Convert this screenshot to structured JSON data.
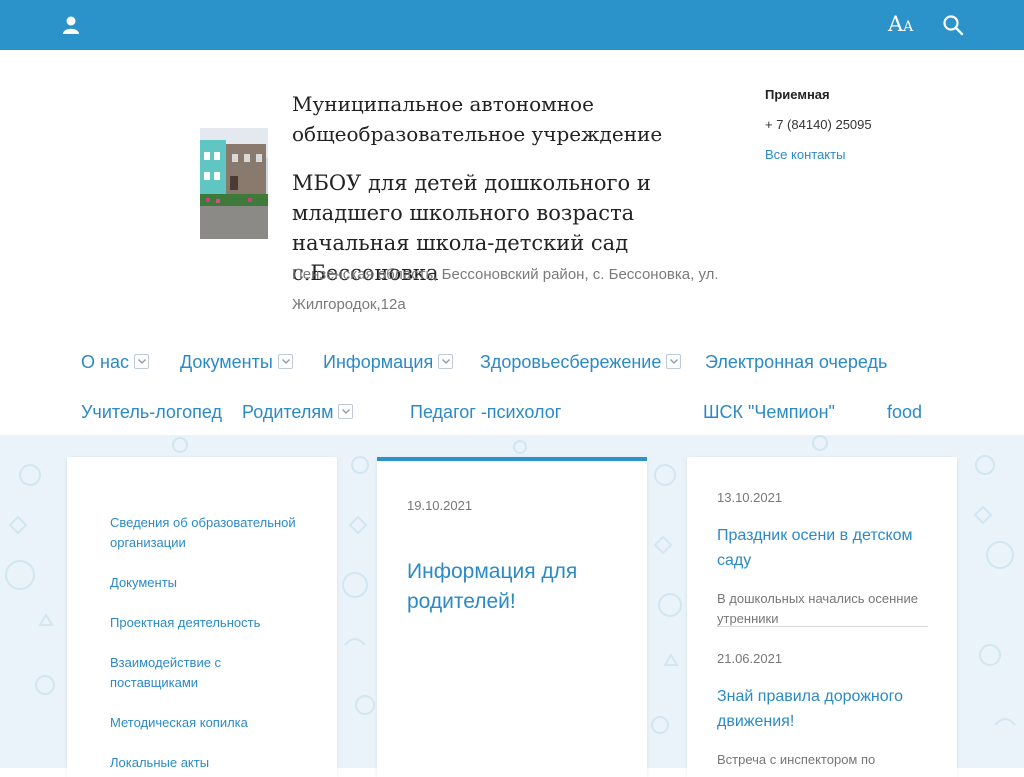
{
  "topbar": {
    "font_toggle_big": "A",
    "font_toggle_small": "A",
    "icons": [
      "user-icon",
      "search-icon"
    ],
    "color": "#2b93c9"
  },
  "header": {
    "org_type": "Муниципальное автономное общеобразовательное учреждение",
    "org_name": "МБОУ для детей дошкольного и младшего школьного возраста начальная школа-детский сад с.Бессоновка",
    "address": "Пензенская область, Бессоновский район, с. Бессоновка, ул. Жилгородок,12а"
  },
  "contacts": {
    "title": "Приемная",
    "phone": "+ 7 (84140) 25095",
    "all_link": "Все контакты"
  },
  "nav": [
    {
      "label": "О нас",
      "dropdown": true
    },
    {
      "label": "Документы",
      "dropdown": true
    },
    {
      "label": "Информация",
      "dropdown": true
    },
    {
      "label": "Здоровьесбережение",
      "dropdown": true
    },
    {
      "label": "Электронная очередь",
      "dropdown": false
    },
    {
      "label": "Учитель-логопед",
      "dropdown": false
    },
    {
      "label": "Родителям",
      "dropdown": true
    },
    {
      "label": "Педагог -психолог",
      "dropdown": false
    },
    {
      "label": "ШСК \"Чемпион\"",
      "dropdown": false
    },
    {
      "label": "food",
      "dropdown": false
    }
  ],
  "sidebar": {
    "items": [
      {
        "label": "Сведения об образовательной организации"
      },
      {
        "label": "Документы"
      },
      {
        "label": "Проектная деятельность"
      },
      {
        "label": "Взаимодействие с поставщиками"
      },
      {
        "label": "Методическая копилка"
      },
      {
        "label": "Локальные акты"
      }
    ]
  },
  "featured": {
    "date": "19.10.2021",
    "title": "Информация для родителей!"
  },
  "news": [
    {
      "date": "13.10.2021",
      "title": "Праздник осени в детском саду",
      "text": "В дошкольных начались осенние утренники"
    },
    {
      "date": "21.06.2021",
      "title": "Знай правила дорожного движения!",
      "text": "Встреча с инспектором по"
    }
  ]
}
